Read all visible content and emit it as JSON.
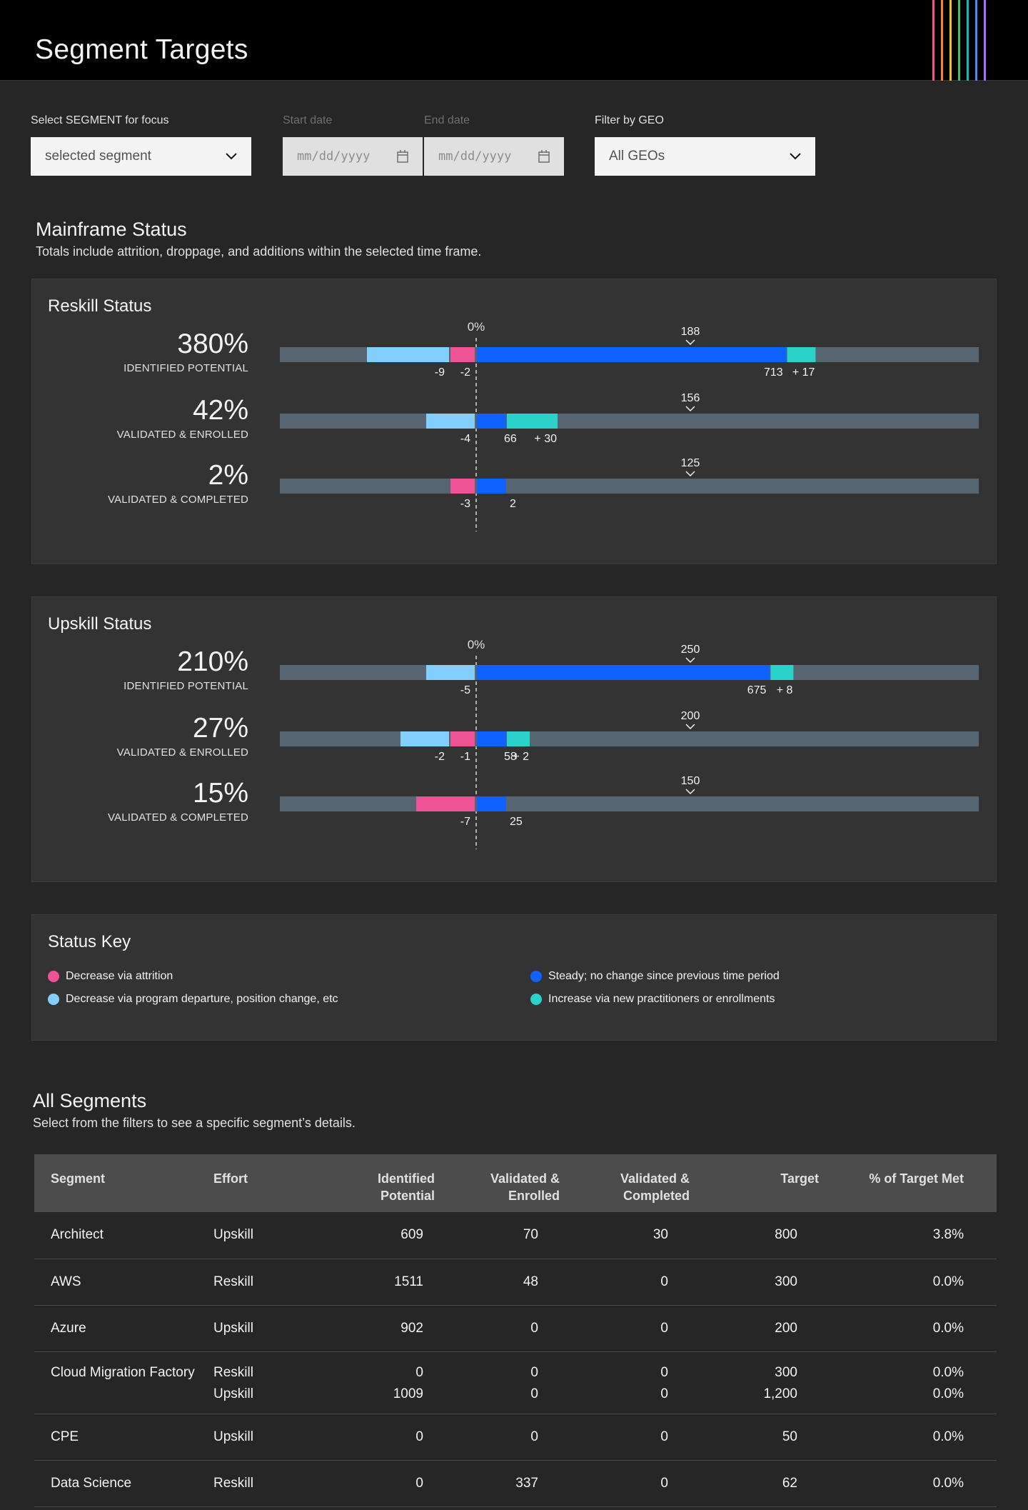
{
  "header": {
    "title": "Segment Targets"
  },
  "filters": {
    "segment_label": "Select SEGMENT for focus",
    "segment_value": "selected segment",
    "start_label": "Start date",
    "start_placeholder": "mm/dd/yyyy",
    "end_label": "End date",
    "end_placeholder": "mm/dd/yyyy",
    "geo_label": "Filter by GEO",
    "geo_value": "All GEOs"
  },
  "mainframe": {
    "title": "Mainframe Status",
    "subtitle": "Totals include attrition, droppage, and additions within the selected time frame."
  },
  "colors": {
    "track": "#576570",
    "attrition": "#ee5396",
    "departure": "#82cfff",
    "steady": "#0f62fe",
    "increase": "#2ad2c9"
  },
  "reskill": {
    "title": "Reskill Status",
    "zero_label": "0%",
    "rows": [
      {
        "pct": "380%",
        "caption": "IDENTIFIED POTENTIAL",
        "target": 188,
        "target_label": "188",
        "departure": 9,
        "attrition": 2,
        "steady": 713,
        "increase": 17,
        "departure_label": "-9",
        "attrition_label": "-2",
        "steady_label": "713",
        "increase_label": "+ 17"
      },
      {
        "pct": "42%",
        "caption": "VALIDATED & ENROLLED",
        "target": 156,
        "target_label": "156",
        "departure": 4,
        "attrition": 0,
        "steady": 66,
        "increase": 30,
        "departure_label": "-4",
        "attrition_label": "",
        "steady_label": "66",
        "increase_label": "+ 30"
      },
      {
        "pct": "2%",
        "caption": "VALIDATED & COMPLETED",
        "target": 125,
        "target_label": "125",
        "departure": 0,
        "attrition": 3,
        "steady": 2,
        "increase": 0,
        "departure_label": "",
        "attrition_label": "-3",
        "steady_label": "2",
        "increase_label": ""
      }
    ]
  },
  "upskill": {
    "title": "Upskill Status",
    "zero_label": "0%",
    "rows": [
      {
        "pct": "210%",
        "caption": "IDENTIFIED POTENTIAL",
        "target": 250,
        "target_label": "250",
        "departure": 5,
        "attrition": 0,
        "steady": 675,
        "increase": 8,
        "departure_label": "-5",
        "attrition_label": "",
        "steady_label": "675",
        "increase_label": "+ 8"
      },
      {
        "pct": "27%",
        "caption": "VALIDATED & ENROLLED",
        "target": 200,
        "target_label": "200",
        "departure": 2,
        "attrition": 1,
        "steady": 58,
        "increase": 2,
        "departure_label": "-2",
        "attrition_label": "-1",
        "steady_label": "58",
        "increase_label": "+ 2"
      },
      {
        "pct": "15%",
        "caption": "VALIDATED & COMPLETED",
        "target": 150,
        "target_label": "150",
        "departure": 0,
        "attrition": 7,
        "steady": 25,
        "increase": 0,
        "departure_label": "",
        "attrition_label": "-7",
        "steady_label": "25",
        "increase_label": ""
      }
    ]
  },
  "status_key": {
    "title": "Status Key",
    "items": [
      {
        "label": "Decrease via attrition",
        "color": "#ee5396"
      },
      {
        "label": "Decrease via program departure, position change, etc",
        "color": "#82cfff"
      },
      {
        "label": "Steady; no change since previous time period",
        "color": "#0f62fe"
      },
      {
        "label": "Increase via new practitioners or enrollments",
        "color": "#2ad2c9"
      }
    ]
  },
  "segments": {
    "title": "All Segments",
    "subtitle": "Select from the filters to see a specific segment’s details.",
    "columns": {
      "segment": "Segment",
      "effort": "Effort",
      "identified_1": "Identified",
      "identified_2": "Potential",
      "enrolled_1": "Validated &",
      "enrolled_2": "Enrolled",
      "completed_1": "Validated &",
      "completed_2": "Completed",
      "target": "Target",
      "pct": "% of Target Met"
    },
    "rows": [
      {
        "segment": "Architect",
        "effort": "Upskill",
        "identified": "609",
        "enrolled": "70",
        "completed": "30",
        "target": "800",
        "pct": "3.8%"
      },
      {
        "segment": "AWS",
        "effort": "Reskill",
        "identified": "1511",
        "enrolled": "48",
        "completed": "0",
        "target": "300",
        "pct": "0.0%"
      },
      {
        "segment": "Azure",
        "effort": "Upskill",
        "identified": "902",
        "enrolled": "0",
        "completed": "0",
        "target": "200",
        "pct": "0.0%"
      },
      {
        "segment": "Cloud Migration Factory",
        "effort": "Reskill",
        "identified": "0",
        "enrolled": "0",
        "completed": "0",
        "target": "300",
        "pct": "0.0%"
      },
      {
        "segment": "",
        "effort": "Upskill",
        "identified": "1009",
        "enrolled": "0",
        "completed": "0",
        "target": "1,200",
        "pct": "0.0%"
      },
      {
        "segment": "CPE",
        "effort": "Upskill",
        "identified": "0",
        "enrolled": "0",
        "completed": "0",
        "target": "50",
        "pct": "0.0%"
      },
      {
        "segment": "Data Science",
        "effort": "Reskill",
        "identified": "0",
        "enrolled": "337",
        "completed": "0",
        "target": "62",
        "pct": "0.0%"
      }
    ]
  }
}
